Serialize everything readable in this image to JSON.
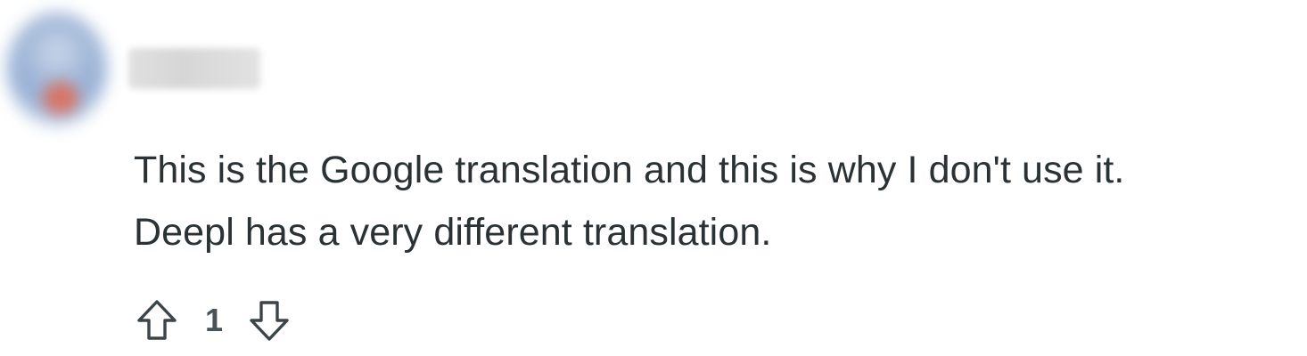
{
  "comment": {
    "author": "",
    "body_lines": [
      "This is the Google translation and this is why I don't use it.",
      "Deepl has a very different translation."
    ],
    "score": "1"
  },
  "icons": {
    "upvote": "arrow-up-outline-icon",
    "downvote": "arrow-down-outline-icon"
  },
  "colors": {
    "text": "#2a3236",
    "icon": "#3b4449",
    "score": "#4a5358"
  }
}
